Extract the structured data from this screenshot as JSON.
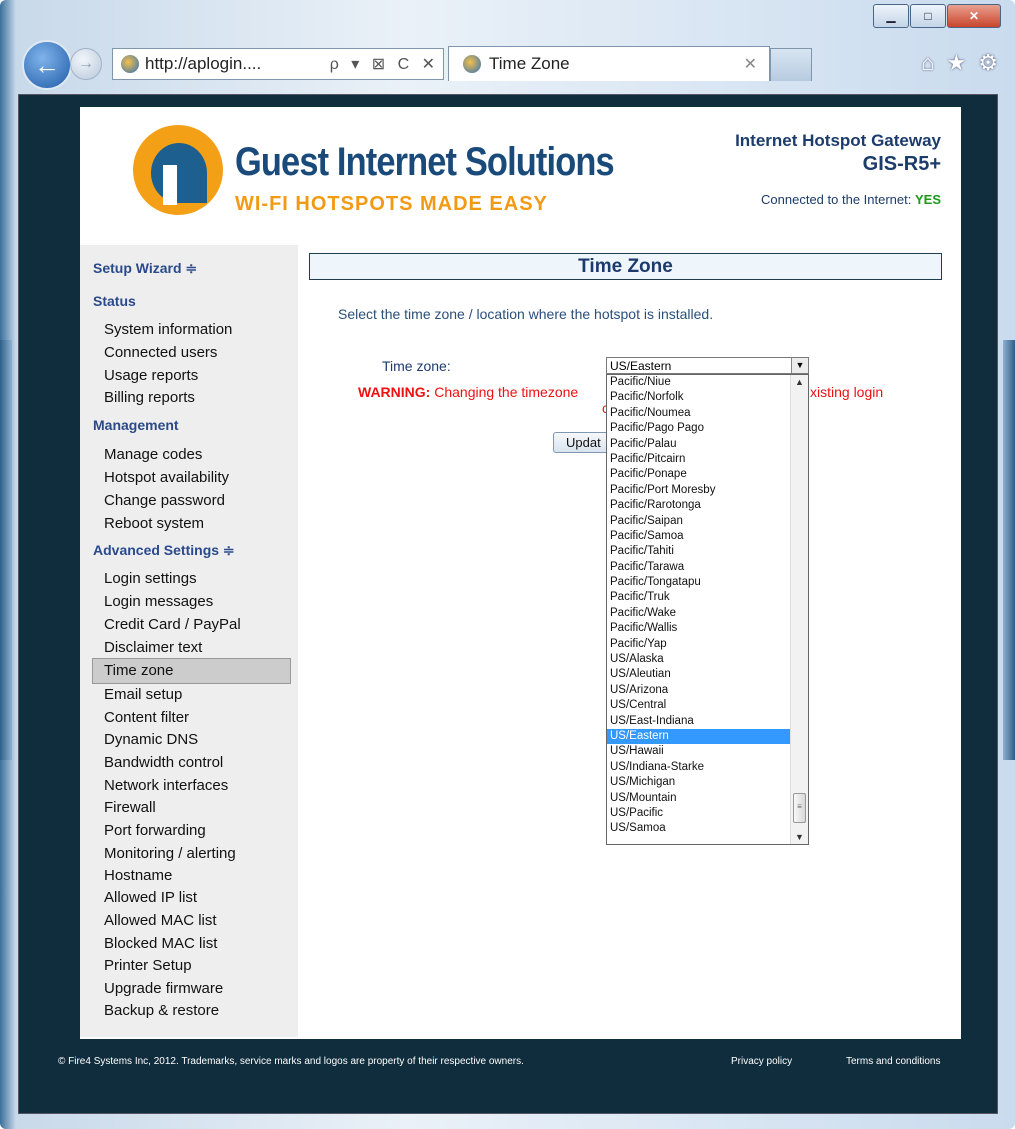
{
  "browser": {
    "address": "http://aplogin....",
    "address_controls": "ρ ▾ ⊠ C ✕",
    "tab_title": "Time Zone",
    "tab_close": "✕",
    "caption_minimize": "▁",
    "caption_maximize": "□",
    "caption_close": "✕",
    "back": "←",
    "forward": "→",
    "home_icon": "⌂",
    "fav_icon": "★",
    "tools_icon": "⚙"
  },
  "header": {
    "logo_name": "Guest Internet Solutions",
    "logo_tag": "WI-FI HOTSPOTS MADE EASY",
    "product_line": "Internet Hotspot Gateway",
    "model": "GIS-R5+",
    "connected_label": "Connected to the Internet:",
    "connected_value": "YES"
  },
  "sidebar": {
    "setup_wizard": "Setup Wizard ≑",
    "status": "Status",
    "status_items": [
      "System information",
      "Connected users",
      "Usage reports",
      "Billing reports"
    ],
    "management": "Management",
    "management_items": [
      "Manage codes",
      "Hotspot availability",
      "Change password",
      "Reboot system"
    ],
    "advanced": "Advanced Settings ≑",
    "advanced_items": [
      "Login settings",
      "Login messages",
      "Credit Card / PayPal",
      "Disclaimer text",
      "Time zone",
      "Email setup",
      "Content filter",
      "Dynamic DNS",
      "Bandwidth control",
      "Network interfaces",
      "Firewall",
      "Port forwarding",
      "Monitoring / alerting",
      "Hostname",
      "Allowed IP list",
      "Allowed MAC list",
      "Blocked MAC list",
      "Printer Setup",
      "Upgrade firmware",
      "Backup & restore"
    ],
    "selected": "Time zone"
  },
  "main": {
    "title": "Time Zone",
    "instruction": "Select the time zone / location where the hotspot is installed.",
    "tz_label": "Time zone:",
    "warning_bold": "WARNING:",
    "warning_text": "Changing the timezone",
    "warning_tail": "xisting login",
    "warning_line2": "c",
    "update_button": "Updat",
    "selected_value": "US/Eastern",
    "options": [
      "Pacific/Niue",
      "Pacific/Norfolk",
      "Pacific/Noumea",
      "Pacific/Pago Pago",
      "Pacific/Palau",
      "Pacific/Pitcairn",
      "Pacific/Ponape",
      "Pacific/Port Moresby",
      "Pacific/Rarotonga",
      "Pacific/Saipan",
      "Pacific/Samoa",
      "Pacific/Tahiti",
      "Pacific/Tarawa",
      "Pacific/Tongatapu",
      "Pacific/Truk",
      "Pacific/Wake",
      "Pacific/Wallis",
      "Pacific/Yap",
      "US/Alaska",
      "US/Aleutian",
      "US/Arizona",
      "US/Central",
      "US/East-Indiana",
      "US/Eastern",
      "US/Hawaii",
      "US/Indiana-Starke",
      "US/Michigan",
      "US/Mountain",
      "US/Pacific",
      "US/Samoa"
    ],
    "highlighted": "US/Eastern"
  },
  "footer": {
    "copyright": "© Fire4 Systems Inc, 2012. Trademarks, service marks and logos are property of their respective owners.",
    "privacy": "Privacy policy",
    "terms": "Terms and conditions"
  }
}
